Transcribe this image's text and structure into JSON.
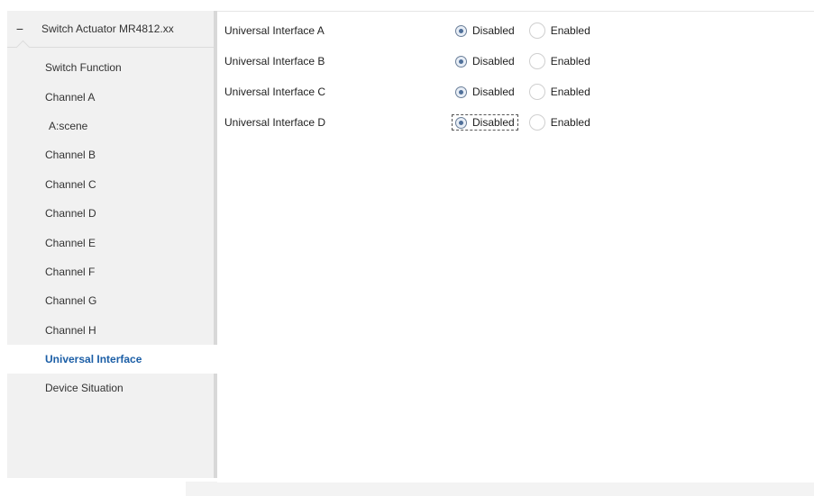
{
  "tree": {
    "toggle_symbol": "−",
    "root_label": "Switch Actuator MR4812.xx"
  },
  "sidebar": {
    "items": [
      {
        "label": "Switch Function"
      },
      {
        "label": "Channel A"
      },
      {
        "label": "A:scene"
      },
      {
        "label": "Channel B"
      },
      {
        "label": "Channel C"
      },
      {
        "label": "Channel D"
      },
      {
        "label": "Channel E"
      },
      {
        "label": "Channel F"
      },
      {
        "label": "Channel G"
      },
      {
        "label": "Channel H"
      },
      {
        "label": "Universal Interface"
      },
      {
        "label": "Device Situation"
      }
    ],
    "active_item": "Universal Interface"
  },
  "parameters": {
    "rows": [
      {
        "label": "Universal Interface A",
        "options": [
          "Disabled",
          "Enabled"
        ],
        "selected": "Disabled"
      },
      {
        "label": "Universal Interface B",
        "options": [
          "Disabled",
          "Enabled"
        ],
        "selected": "Disabled"
      },
      {
        "label": "Universal Interface C",
        "options": [
          "Disabled",
          "Enabled"
        ],
        "selected": "Disabled"
      },
      {
        "label": "Universal Interface D",
        "options": [
          "Disabled",
          "Enabled"
        ],
        "selected": "Disabled"
      }
    ]
  },
  "colors": {
    "active_text": "#1b5ea6",
    "sidebar_bg": "#f1f1f1"
  }
}
